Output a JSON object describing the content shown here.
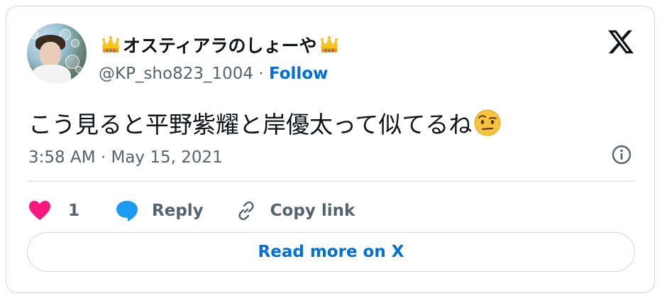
{
  "author": {
    "display_name": "オスティアラのしょーや",
    "handle": "@KP_sho823_1004",
    "separator": "·",
    "follow_label": "Follow",
    "name_emoji": "crown-icon"
  },
  "tweet": {
    "text": "こう見ると平野紫耀と岸優太って似てるね",
    "trailing_emoji": "face-with-raised-eyebrow-icon",
    "timestamp": "3:58 AM · May 15, 2021"
  },
  "actions": {
    "like_count": "1",
    "reply_label": "Reply",
    "copy_link_label": "Copy link"
  },
  "read_more_label": "Read more on X",
  "colors": {
    "text_primary": "#0f1419",
    "text_secondary": "#536471",
    "link_blue": "#006fd6",
    "like_pink": "#f91880",
    "reply_blue": "#1d9bf0",
    "border": "#cfd9de"
  }
}
